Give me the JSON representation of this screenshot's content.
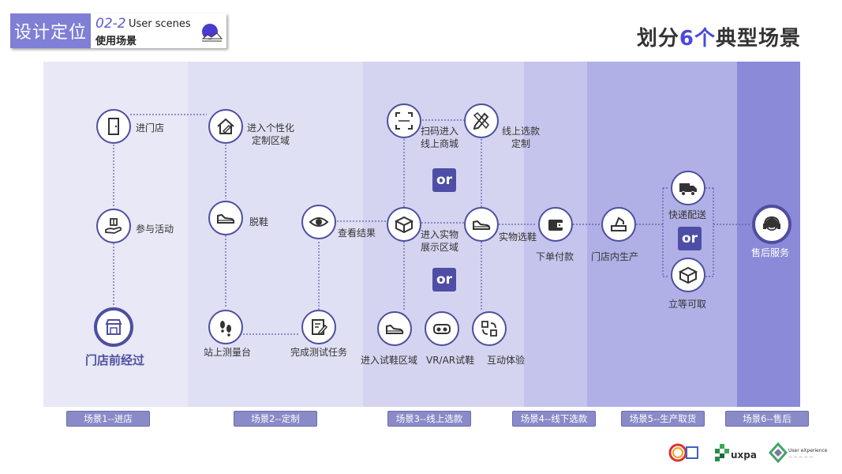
{
  "header": {
    "badge": "设计定位",
    "code": "02-2",
    "subtitle_en": "User scenes",
    "subtitle_cn": "使用场景"
  },
  "title": {
    "prefix": "划分",
    "highlight": "6个",
    "suffix": "典型场景"
  },
  "colors": {
    "accent": "#4a4ad8",
    "node_border": "#4e4ea0",
    "band1": "#e8e8f6",
    "band2": "#e0e0f4",
    "band3": "#d4d4f0",
    "band4": "#c4c4ec",
    "band5": "#b0b0e6",
    "band6": "#8a8ad8"
  },
  "or_label": "or",
  "start_label": "门店前经过",
  "nodes": {
    "enter_store": "进门店",
    "join_event": "参与活动",
    "custom_area": "进入个性化\n定制区域",
    "take_off_shoes": "脱鞋",
    "stand_measure": "站上测量台",
    "view_result": "查看结果",
    "finish_test": "完成测试任务",
    "scan_code": "扫码进入\n线上商城",
    "online_custom": "线上选款\n定制",
    "enter_showroom": "进入实物\n展示区域",
    "physical_select": "实物选鞋",
    "try_on_area": "进入试鞋区域",
    "vr_ar": "VR/AR试鞋",
    "interactive": "互动体验",
    "place_order": "下单付款",
    "store_produce": "门店内生产",
    "express": "快递配送",
    "pickup": "立等可取",
    "after_sales": "售后服务"
  },
  "scenes": [
    "场景1--进店",
    "场景2--定制",
    "场景3--线上选款",
    "场景4--线下选款",
    "场景5--生产取货",
    "场景6--售后"
  ]
}
